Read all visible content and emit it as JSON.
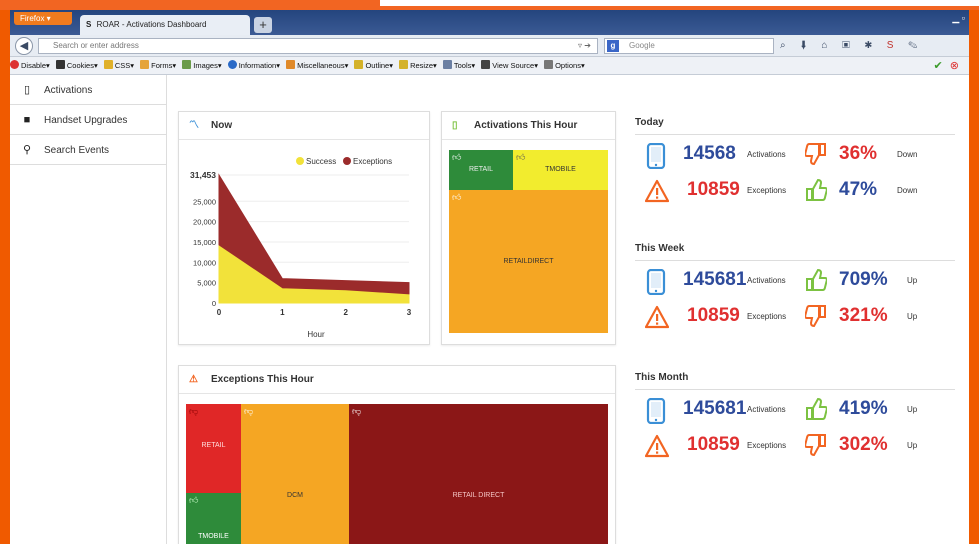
{
  "browser": {
    "firefox_button": "Firefox",
    "tab_title": "ROAR - Activations Dashboard",
    "tab_favicon": "S",
    "url_placeholder": "Search or enter address",
    "search_placeholder": "Google",
    "search_engine_letter": "g"
  },
  "devbar": {
    "items": [
      "Disable▾",
      "Cookies▾",
      "CSS▾",
      "Forms▾",
      "Images▾",
      "Information▾",
      "Miscellaneous▾",
      "Outline▾",
      "Resize▾",
      "Tools▾",
      "View Source▾",
      "Options▾"
    ]
  },
  "sidebar": {
    "items": [
      {
        "label": "Activations",
        "icon": "phone-icon"
      },
      {
        "label": "Handset Upgrades",
        "icon": "document-icon"
      },
      {
        "label": "Search Events",
        "icon": "search-icon"
      }
    ]
  },
  "now_panel": {
    "title": "Now",
    "legend_success": "Success",
    "legend_exceptions": "Exceptions",
    "peak_label": "31,453"
  },
  "chart_data": {
    "type": "area",
    "x": [
      0,
      1,
      2,
      3
    ],
    "xlabel": "Hour",
    "ylabel": "",
    "ylim": [
      0,
      31453
    ],
    "yticks": [
      "0",
      "5,000",
      "10,000",
      "15,000",
      "20,000",
      "25,000",
      "31,453"
    ],
    "xticks": [
      "0",
      "1",
      "2",
      "3"
    ],
    "series": [
      {
        "name": "Success",
        "values": [
          14000,
          3500,
          3000,
          2000
        ],
        "color": "#f2e23a"
      },
      {
        "name": "Exceptions",
        "values": [
          31453,
          6000,
          5500,
          5000
        ],
        "color": "#9b2b2b"
      }
    ],
    "legend": "top-right"
  },
  "activations_panel": {
    "title": "Activations This Hour",
    "cells": [
      {
        "label": "RETAIL",
        "color": "#2e8b3a"
      },
      {
        "label": "TMOBILE",
        "color": "#f2ec2e"
      },
      {
        "label": "RETAILDIRECT",
        "color": "#f5a623"
      }
    ]
  },
  "exceptions_panel": {
    "title": "Exceptions This Hour",
    "cells": [
      {
        "label": "RETAIL",
        "color": "#e02727"
      },
      {
        "label": "TMOBILE",
        "color": "#2e8b3a"
      },
      {
        "label": "DCM",
        "color": "#f5a623"
      },
      {
        "label": "RETAIL DIRECT",
        "color": "#8b1717"
      }
    ]
  },
  "stats": {
    "today": {
      "title": "Today",
      "activations": {
        "value": "14568",
        "label": "Activations",
        "pct": "36%",
        "dir": "Down",
        "thumb": "thumbs-down"
      },
      "exceptions": {
        "value": "10859",
        "label": "Exceptions",
        "pct": "47%",
        "dir": "Down",
        "thumb": "thumbs-up"
      }
    },
    "week": {
      "title": "This Week",
      "activations": {
        "value": "145681",
        "label": "Activations",
        "pct": "709%",
        "dir": "Up",
        "thumb": "thumbs-up"
      },
      "exceptions": {
        "value": "10859",
        "label": "Exceptions",
        "pct": "321%",
        "dir": "Up",
        "thumb": "thumbs-down"
      }
    },
    "month": {
      "title": "This Month",
      "activations": {
        "value": "145681",
        "label": "Activations",
        "pct": "419%",
        "dir": "Up",
        "thumb": "thumbs-up"
      },
      "exceptions": {
        "value": "10859",
        "label": "Exceptions",
        "pct": "302%",
        "dir": "Up",
        "thumb": "thumbs-down"
      }
    }
  },
  "colors": {
    "blue": "#2e4b9b",
    "red": "#e03030",
    "green": "#7cc242",
    "orange": "#f26522"
  }
}
